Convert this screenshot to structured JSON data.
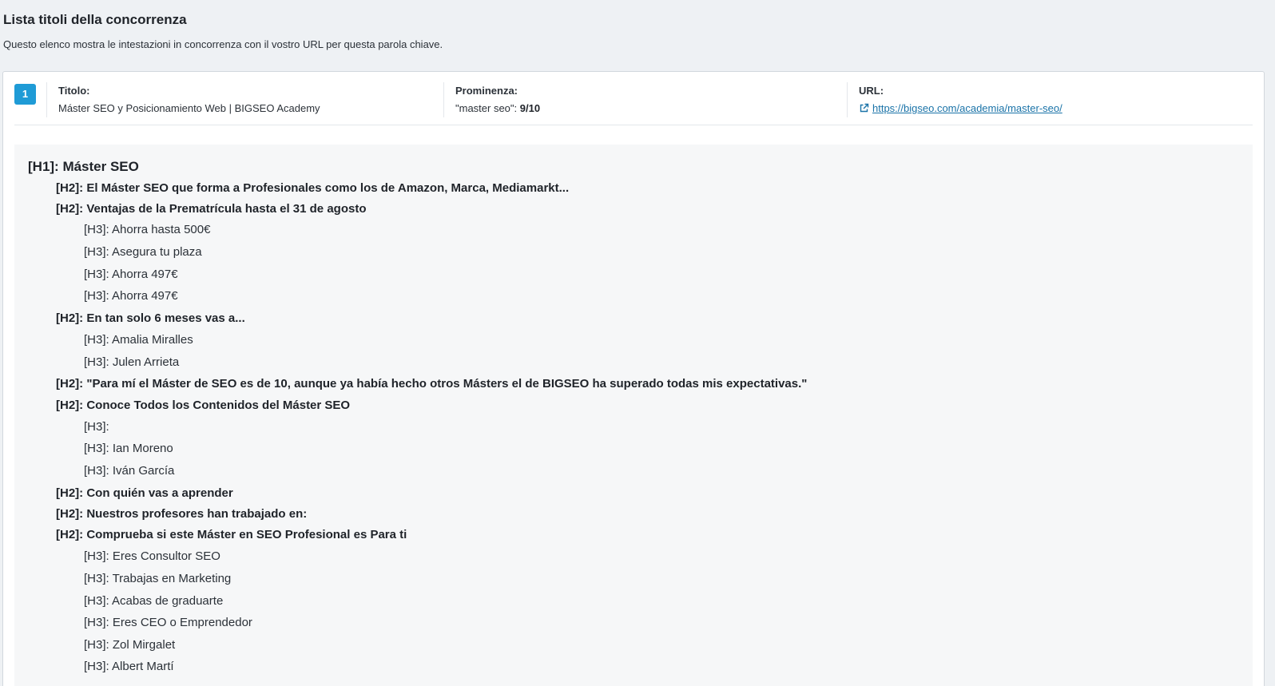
{
  "header": {
    "title": "Lista titoli della concorrenza",
    "description": "Questo elenco mostra le intestazioni in concorrenza con il vostro URL per questa parola chiave."
  },
  "result": {
    "rank": "1",
    "title_label": "Titolo:",
    "title_value": "Máster SEO y Posicionamiento Web | BIGSEO Academy",
    "prominence_label": "Prominenza:",
    "prominence_keyword": "\"master seo\": ",
    "prominence_score": "9/10",
    "url_label": "URL:",
    "url_value": "https://bigseo.com/academia/master-seo/",
    "url_icon": "external-link-icon"
  },
  "headings": [
    {
      "level": "h1",
      "text": "[H1]: Máster SEO"
    },
    {
      "level": "h2",
      "text": "[H2]: El Máster SEO que forma a Profesionales como los de Amazon, Marca, Mediamarkt..."
    },
    {
      "level": "h2",
      "text": "[H2]: Ventajas de la Prematrícula hasta el 31 de agosto"
    },
    {
      "level": "h3",
      "text": "[H3]: Ahorra hasta 500€"
    },
    {
      "level": "h3",
      "text": "[H3]: Asegura tu plaza"
    },
    {
      "level": "h3",
      "text": "[H3]: Ahorra 497€"
    },
    {
      "level": "h3",
      "text": "[H3]: Ahorra 497€"
    },
    {
      "level": "h2",
      "text": "[H2]: En tan solo 6 meses vas a..."
    },
    {
      "level": "h3",
      "text": "[H3]: Amalia Miralles"
    },
    {
      "level": "h3",
      "text": "[H3]: Julen Arrieta"
    },
    {
      "level": "h2",
      "text": "[H2]: \"Para mí el Máster de SEO es de 10, aunque ya había hecho otros Másters el de BIGSEO ha superado todas mis expectativas.\""
    },
    {
      "level": "h2",
      "text": "[H2]: Conoce Todos los Contenidos del Máster SEO"
    },
    {
      "level": "h3",
      "text": "[H3]:"
    },
    {
      "level": "h3",
      "text": "[H3]: Ian Moreno"
    },
    {
      "level": "h3",
      "text": "[H3]: Iván García"
    },
    {
      "level": "h2",
      "text": "[H2]: Con quién vas a aprender"
    },
    {
      "level": "h2",
      "text": "[H2]: Nuestros profesores han trabajado en:"
    },
    {
      "level": "h2",
      "text": "[H2]: Comprueba si este Máster en SEO Profesional es Para ti"
    },
    {
      "level": "h3",
      "text": "[H3]: Eres Consultor SEO"
    },
    {
      "level": "h3",
      "text": "[H3]: Trabajas en Marketing"
    },
    {
      "level": "h3",
      "text": "[H3]: Acabas de graduarte"
    },
    {
      "level": "h3",
      "text": "[H3]: Eres CEO o Emprendedor"
    },
    {
      "level": "h3",
      "text": "[H3]: Zol Mirgalet"
    },
    {
      "level": "h3",
      "text": "[H3]: Albert Martí"
    }
  ]
}
